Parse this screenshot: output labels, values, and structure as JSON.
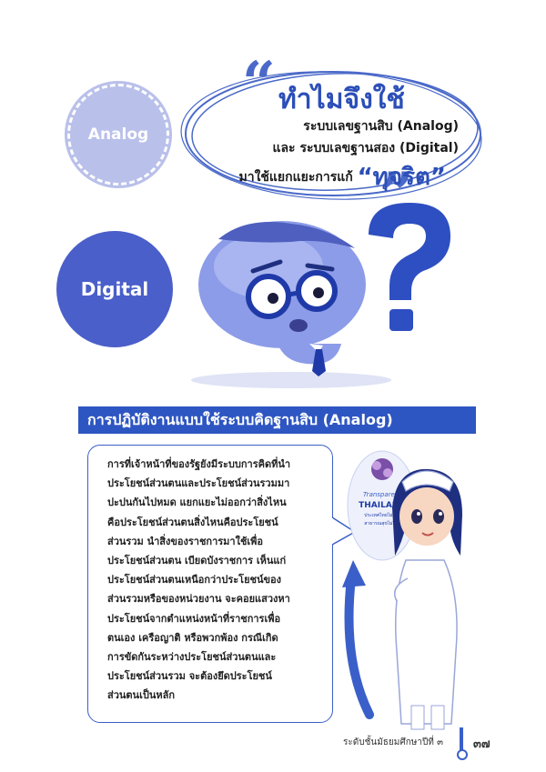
{
  "circles": {
    "analog_label": "Analog",
    "digital_label": "Digital"
  },
  "title": {
    "main": "ทำไมจึงใช้",
    "line1": "ระบบเลขฐานสิบ (Analog)",
    "line2": "และ ระบบเลขฐานสอง (Digital)",
    "line3_prefix": "มาใช้แยกแยะการแก้",
    "line3_highlight": "“ทุจริต”"
  },
  "section": {
    "header": "การปฏิบัติงานแบบใช้ระบบคิดฐานสิบ (Analog)"
  },
  "body_lines": [
    "การที่เจ้าหน้าที่ของรัฐยังมีระบบการคิดที่นำ",
    "ประโยชน์ส่วนตนและประโยชน์ส่วนรวมมา",
    "ปะปนกันไปหมด แยกแยะไม่ออกว่าสิ่งไหน",
    "คือประโยชน์ส่วนตนสิ่งไหนคือประโยชน์",
    "ส่วนรวม นำสิ่งของราชการมาใช้เพื่อ",
    "ประโยชน์ส่วนตน เบียดบังราชการ เห็นแก่",
    "ประโยชน์ส่วนตนเหนือกว่าประโยชน์ของ",
    "ส่วนรวมหรือของหน่วยงาน จะคอยแสวงหา",
    "ประโยชน์จากตำแหน่งหน้าที่ราชการเพื่อ",
    "ตนเอง เครือญาติ หรือพวกพ้อง กรณีเกิด",
    "การขัดกันระหว่างประโยชน์ส่วนตนและ",
    "ประโยชน์ส่วนรวม จะต้องยึดประโยชน์",
    "ส่วนตนเป็นหลัก"
  ],
  "nurse_badge": {
    "line1": "Transparent",
    "line2": "THAILAND",
    "line3": "ประเทศไทยไม่โกง",
    "line4": "สาธารณสุขไม่โกง"
  },
  "footer": {
    "text": "ระดับชั้นมัธยมศึกษาปีที่ ๓",
    "page": "๓๗"
  },
  "colors": {
    "accent": "#2e56c2",
    "light_circle": "#b9c0ea",
    "dark_circle": "#4a5fc9"
  }
}
